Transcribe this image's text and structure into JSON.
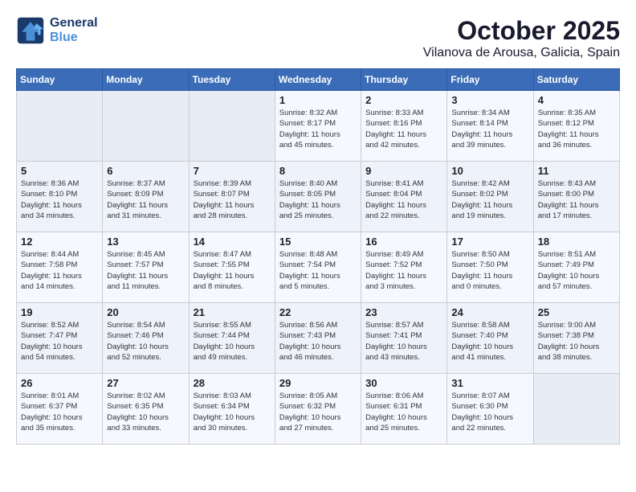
{
  "logo": {
    "line1": "General",
    "line2": "Blue"
  },
  "title": "October 2025",
  "subtitle": "Vilanova de Arousa, Galicia, Spain",
  "weekdays": [
    "Sunday",
    "Monday",
    "Tuesday",
    "Wednesday",
    "Thursday",
    "Friday",
    "Saturday"
  ],
  "weeks": [
    [
      {
        "day": "",
        "info": ""
      },
      {
        "day": "",
        "info": ""
      },
      {
        "day": "",
        "info": ""
      },
      {
        "day": "1",
        "info": "Sunrise: 8:32 AM\nSunset: 8:17 PM\nDaylight: 11 hours\nand 45 minutes."
      },
      {
        "day": "2",
        "info": "Sunrise: 8:33 AM\nSunset: 8:16 PM\nDaylight: 11 hours\nand 42 minutes."
      },
      {
        "day": "3",
        "info": "Sunrise: 8:34 AM\nSunset: 8:14 PM\nDaylight: 11 hours\nand 39 minutes."
      },
      {
        "day": "4",
        "info": "Sunrise: 8:35 AM\nSunset: 8:12 PM\nDaylight: 11 hours\nand 36 minutes."
      }
    ],
    [
      {
        "day": "5",
        "info": "Sunrise: 8:36 AM\nSunset: 8:10 PM\nDaylight: 11 hours\nand 34 minutes."
      },
      {
        "day": "6",
        "info": "Sunrise: 8:37 AM\nSunset: 8:09 PM\nDaylight: 11 hours\nand 31 minutes."
      },
      {
        "day": "7",
        "info": "Sunrise: 8:39 AM\nSunset: 8:07 PM\nDaylight: 11 hours\nand 28 minutes."
      },
      {
        "day": "8",
        "info": "Sunrise: 8:40 AM\nSunset: 8:05 PM\nDaylight: 11 hours\nand 25 minutes."
      },
      {
        "day": "9",
        "info": "Sunrise: 8:41 AM\nSunset: 8:04 PM\nDaylight: 11 hours\nand 22 minutes."
      },
      {
        "day": "10",
        "info": "Sunrise: 8:42 AM\nSunset: 8:02 PM\nDaylight: 11 hours\nand 19 minutes."
      },
      {
        "day": "11",
        "info": "Sunrise: 8:43 AM\nSunset: 8:00 PM\nDaylight: 11 hours\nand 17 minutes."
      }
    ],
    [
      {
        "day": "12",
        "info": "Sunrise: 8:44 AM\nSunset: 7:58 PM\nDaylight: 11 hours\nand 14 minutes."
      },
      {
        "day": "13",
        "info": "Sunrise: 8:45 AM\nSunset: 7:57 PM\nDaylight: 11 hours\nand 11 minutes."
      },
      {
        "day": "14",
        "info": "Sunrise: 8:47 AM\nSunset: 7:55 PM\nDaylight: 11 hours\nand 8 minutes."
      },
      {
        "day": "15",
        "info": "Sunrise: 8:48 AM\nSunset: 7:54 PM\nDaylight: 11 hours\nand 5 minutes."
      },
      {
        "day": "16",
        "info": "Sunrise: 8:49 AM\nSunset: 7:52 PM\nDaylight: 11 hours\nand 3 minutes."
      },
      {
        "day": "17",
        "info": "Sunrise: 8:50 AM\nSunset: 7:50 PM\nDaylight: 11 hours\nand 0 minutes."
      },
      {
        "day": "18",
        "info": "Sunrise: 8:51 AM\nSunset: 7:49 PM\nDaylight: 10 hours\nand 57 minutes."
      }
    ],
    [
      {
        "day": "19",
        "info": "Sunrise: 8:52 AM\nSunset: 7:47 PM\nDaylight: 10 hours\nand 54 minutes."
      },
      {
        "day": "20",
        "info": "Sunrise: 8:54 AM\nSunset: 7:46 PM\nDaylight: 10 hours\nand 52 minutes."
      },
      {
        "day": "21",
        "info": "Sunrise: 8:55 AM\nSunset: 7:44 PM\nDaylight: 10 hours\nand 49 minutes."
      },
      {
        "day": "22",
        "info": "Sunrise: 8:56 AM\nSunset: 7:43 PM\nDaylight: 10 hours\nand 46 minutes."
      },
      {
        "day": "23",
        "info": "Sunrise: 8:57 AM\nSunset: 7:41 PM\nDaylight: 10 hours\nand 43 minutes."
      },
      {
        "day": "24",
        "info": "Sunrise: 8:58 AM\nSunset: 7:40 PM\nDaylight: 10 hours\nand 41 minutes."
      },
      {
        "day": "25",
        "info": "Sunrise: 9:00 AM\nSunset: 7:38 PM\nDaylight: 10 hours\nand 38 minutes."
      }
    ],
    [
      {
        "day": "26",
        "info": "Sunrise: 8:01 AM\nSunset: 6:37 PM\nDaylight: 10 hours\nand 35 minutes."
      },
      {
        "day": "27",
        "info": "Sunrise: 8:02 AM\nSunset: 6:35 PM\nDaylight: 10 hours\nand 33 minutes."
      },
      {
        "day": "28",
        "info": "Sunrise: 8:03 AM\nSunset: 6:34 PM\nDaylight: 10 hours\nand 30 minutes."
      },
      {
        "day": "29",
        "info": "Sunrise: 8:05 AM\nSunset: 6:32 PM\nDaylight: 10 hours\nand 27 minutes."
      },
      {
        "day": "30",
        "info": "Sunrise: 8:06 AM\nSunset: 6:31 PM\nDaylight: 10 hours\nand 25 minutes."
      },
      {
        "day": "31",
        "info": "Sunrise: 8:07 AM\nSunset: 6:30 PM\nDaylight: 10 hours\nand 22 minutes."
      },
      {
        "day": "",
        "info": ""
      }
    ]
  ]
}
